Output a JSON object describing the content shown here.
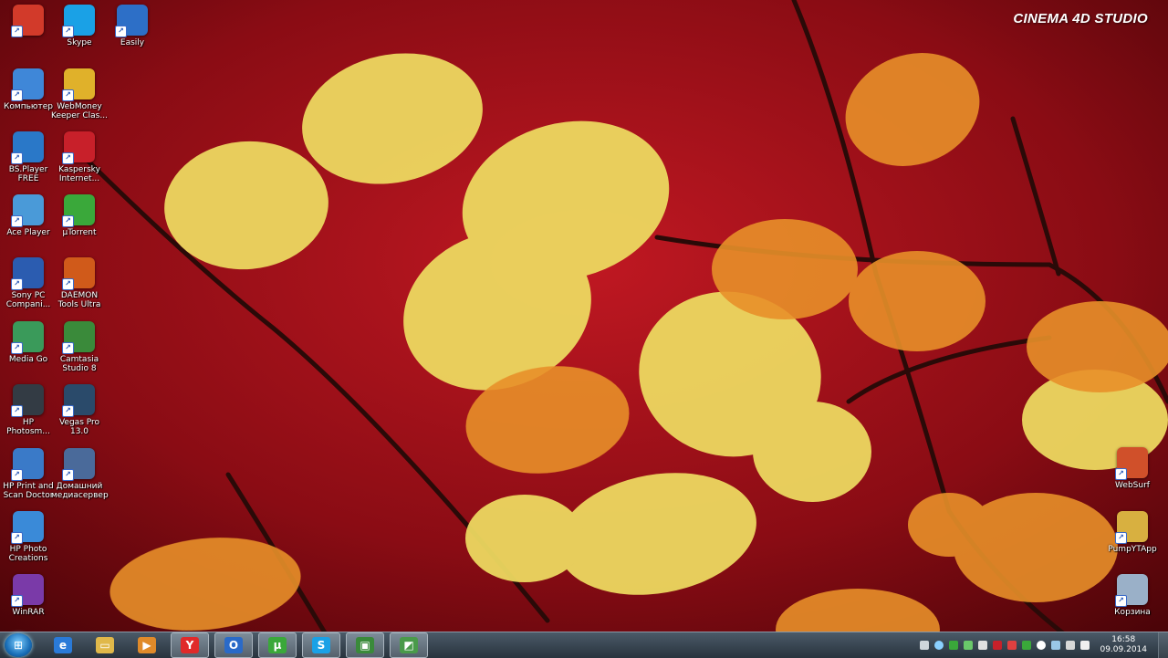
{
  "watermark": "CINEMA 4D STUDIO",
  "desktop_icons": [
    {
      "label": "",
      "icon": "yk-logo-icon",
      "color": "#d23a2a"
    },
    {
      "label": "Skype",
      "icon": "skype-icon",
      "color": "#1aa1e6"
    },
    {
      "label": "Easily",
      "icon": "easily-icon",
      "color": "#2d6fc7"
    },
    {
      "label": "Компьютер",
      "icon": "computer-icon",
      "color": "#3f87d8"
    },
    {
      "label": "WebMoney Keeper Clas...",
      "icon": "webmoney-icon",
      "color": "#e0b12a"
    },
    {
      "label": "BS.Player FREE",
      "icon": "bsplayer-icon",
      "color": "#2a78c8"
    },
    {
      "label": "Kaspersky Internet...",
      "icon": "kaspersky-icon",
      "color": "#c8202a"
    },
    {
      "label": "Ace Player",
      "icon": "ace-player-icon",
      "color": "#4a9ad8"
    },
    {
      "label": "µTorrent",
      "icon": "utorrent-icon",
      "color": "#3aa83a"
    },
    {
      "label": "Sony PC Compani...",
      "icon": "sony-pc-icon",
      "color": "#2b5cb0"
    },
    {
      "label": "DAEMON Tools Ultra",
      "icon": "daemon-tools-icon",
      "color": "#d05a1a"
    },
    {
      "label": "Media Go",
      "icon": "media-go-icon",
      "color": "#3a9a5a"
    },
    {
      "label": "Camtasia Studio 8",
      "icon": "camtasia-icon",
      "color": "#3a8a3a"
    },
    {
      "label": "HP Photosm...",
      "icon": "hp-photosmart-icon",
      "color": "#333b44"
    },
    {
      "label": "Vegas Pro 13.0",
      "icon": "vegas-pro-icon",
      "color": "#2a4a6a"
    },
    {
      "label": "HP Print and Scan Doctor",
      "icon": "hp-print-scan-icon",
      "color": "#3a7ac8"
    },
    {
      "label": "Домашний медиасервер",
      "icon": "media-server-icon",
      "color": "#4a6a9a"
    },
    {
      "label": "HP Photo Creations",
      "icon": "hp-photo-creations-icon",
      "color": "#3a8ad8"
    },
    {
      "label": "WinRAR",
      "icon": "winrar-icon",
      "color": "#7a3aa8"
    },
    {
      "label": "WebSurf",
      "icon": "websurf-icon",
      "color": "#d0502a"
    },
    {
      "label": "PumpYTApp",
      "icon": "folder-icon",
      "color": "#d8b040"
    },
    {
      "label": "Корзина",
      "icon": "recycle-bin-icon",
      "color": "#9ab0c8"
    }
  ],
  "taskbar": {
    "pinned": [
      {
        "name": "internet-explorer",
        "color": "#2a7ad8",
        "glyph": "e"
      },
      {
        "name": "explorer",
        "color": "#e0b84a",
        "glyph": "▭"
      },
      {
        "name": "media-player",
        "color": "#e08a2a",
        "glyph": "▶"
      },
      {
        "name": "yandex-browser",
        "color": "#e02a2a",
        "glyph": "Y"
      },
      {
        "name": "outlook",
        "color": "#2a6ac8",
        "glyph": "O"
      },
      {
        "name": "utorrent",
        "color": "#3aa83a",
        "glyph": "µ"
      },
      {
        "name": "skype",
        "color": "#1aa1e6",
        "glyph": "S"
      },
      {
        "name": "camtasia-recorder",
        "color": "#3a8a3a",
        "glyph": "▣"
      },
      {
        "name": "camtasia-studio",
        "color": "#4a9a4a",
        "glyph": "◩"
      }
    ],
    "clock_time": "16:58",
    "clock_date": "09.09.2014"
  }
}
